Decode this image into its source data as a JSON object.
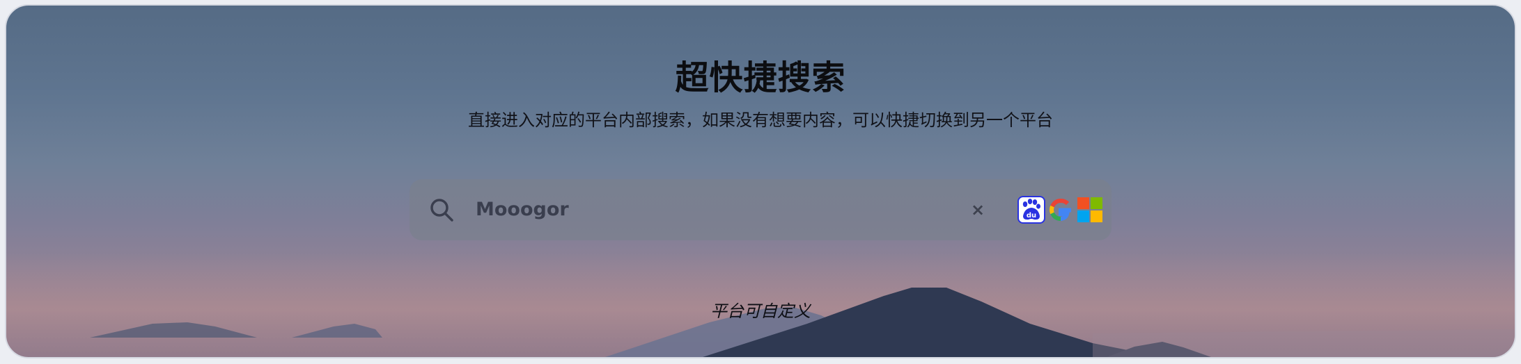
{
  "header": {
    "title": "超快捷搜索",
    "subtitle": "直接进入对应的平台内部搜索，如果没有想要内容，可以快捷切换到另一个平台"
  },
  "search": {
    "value": "Mooogor",
    "clear_label": "×",
    "icon": "search-icon"
  },
  "engines": [
    {
      "name": "Baidu",
      "icon": "baidu-icon",
      "label": "du"
    },
    {
      "name": "Google",
      "icon": "google-icon"
    },
    {
      "name": "Microsoft",
      "icon": "microsoft-icon"
    }
  ],
  "footer": {
    "label": "平台可自定义"
  },
  "colors": {
    "baidu_blue": "#2932e1",
    "google_red": "#ea4335",
    "google_yellow": "#fbbc05",
    "google_green": "#34a853",
    "google_blue": "#4285f4",
    "ms_red": "#f25022",
    "ms_green": "#7fba00",
    "ms_blue": "#00a4ef",
    "ms_yellow": "#ffb900"
  }
}
